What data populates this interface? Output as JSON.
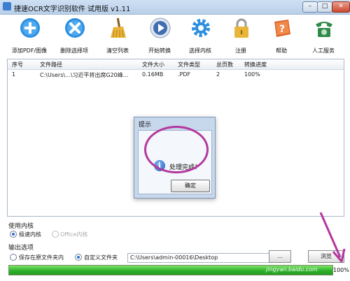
{
  "window": {
    "title": "捷速OCR文字识别软件 试用版 v1.11",
    "min_glyph": "–",
    "max_glyph": "□",
    "close_glyph": "✕"
  },
  "toolbar": {
    "items": [
      {
        "label": "添加PDF/图像",
        "icon": "add-icon",
        "color": "#2d8fe0"
      },
      {
        "label": "删除选择项",
        "icon": "delete-icon",
        "color": "#2d8fe0"
      },
      {
        "label": "清空列表",
        "icon": "broom-icon",
        "color": "#e0a72d"
      },
      {
        "label": "开始转换",
        "icon": "play-icon",
        "color": "#3f6fb0"
      },
      {
        "label": "选择内核",
        "icon": "gear-icon",
        "color": "#2d8fe0"
      },
      {
        "label": "注册",
        "icon": "lock-icon",
        "color": "#e9b43a"
      },
      {
        "label": "帮助",
        "icon": "help-book-icon",
        "color": "#e0662d"
      },
      {
        "label": "人工服务",
        "icon": "phone-icon",
        "color": "#2f8a4a"
      }
    ]
  },
  "file_list": {
    "columns": [
      "序号",
      "文件路径",
      "文件大小",
      "文件类型",
      "总页数",
      "转换进度"
    ],
    "rows": [
      [
        "1",
        "C:\\Users\\...\\习近平将出席G20峰...",
        "0.16MB",
        ".PDF",
        "2",
        "100%"
      ]
    ]
  },
  "dialog": {
    "title": "提示",
    "message": "处理完成！",
    "ok_label": "确定"
  },
  "engine": {
    "label": "使用内核",
    "options": [
      {
        "label": "极速内核",
        "selected": true,
        "enabled": true
      },
      {
        "label": "Office内核",
        "selected": false,
        "enabled": false
      }
    ]
  },
  "output": {
    "label": "输出选项",
    "options": [
      {
        "label": "保存在原文件夹内",
        "selected": false
      },
      {
        "label": "自定义文件夹",
        "selected": true
      }
    ],
    "path": "C:\\Users\\admin-00016\\Desktop",
    "browse_label": "...",
    "action_label": "浏览"
  },
  "progress": {
    "value": 1.0,
    "text": "100%"
  },
  "watermark": "jingyan.baidu.com",
  "colors": {
    "annotation": "#b3389e",
    "progress": "#2fb12a",
    "accent": "#2d8fe0"
  }
}
